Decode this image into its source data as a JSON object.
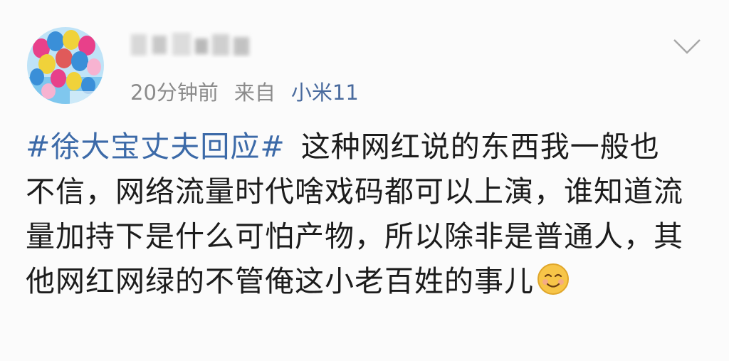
{
  "post": {
    "author": {
      "avatar_icon": "balloons-avatar-icon",
      "name_blurred": true
    },
    "time_ago": "20分钟前",
    "source_prefix": "来自",
    "source_device": "小米11",
    "menu_icon": "chevron-down-icon",
    "hashtag": "#徐大宝丈夫回应#",
    "body_text": "这种网红说的东西我一般也不信，网络流量时代啥戏码都可以上演，谁知道流量加持下是什么可怕产物，所以除非是普通人，其他网红网绿的不管俺这小老百姓的事儿",
    "trailing_emoji": "smiling-face-emoji-icon"
  },
  "colors": {
    "link": "#3c6aa8",
    "source_link": "#4a6b9e",
    "meta_gray": "#8b8b8b",
    "text": "#1c1c1c"
  }
}
